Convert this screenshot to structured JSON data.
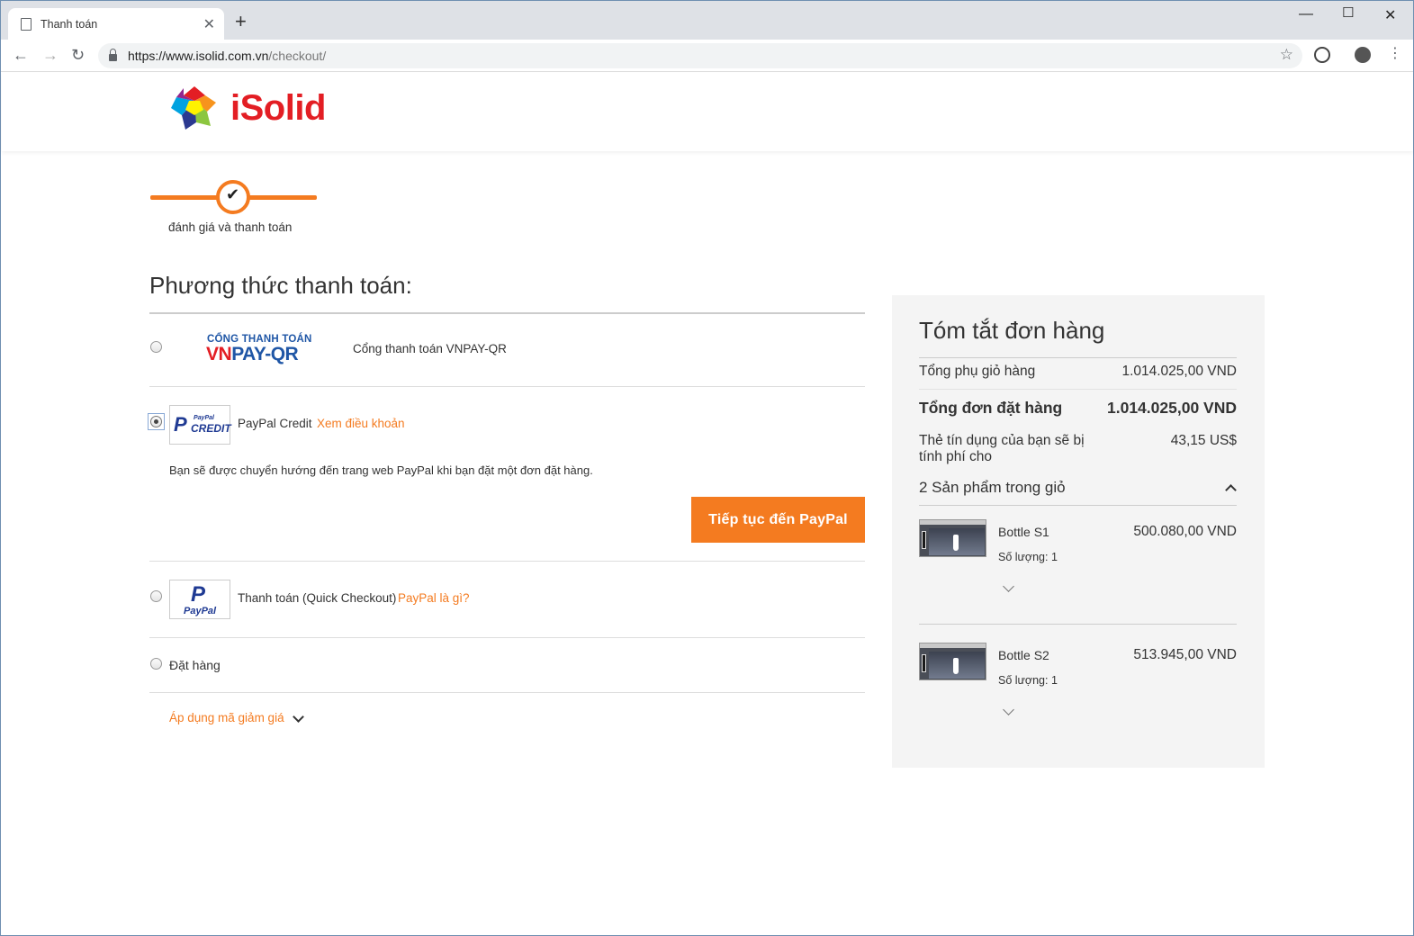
{
  "browser": {
    "tab_title": "Thanh toán",
    "url_host": "https://www.isolid.com.vn",
    "url_path": "/checkout/"
  },
  "header": {
    "brand": "iSolid",
    "brand_color": "#e31e24"
  },
  "progress": {
    "step_label": "đánh giá và thanh toán"
  },
  "payment": {
    "title": "Phương thức thanh toán:",
    "accent_color": "#f47b20",
    "methods": [
      {
        "logo_top": "CỔNG THANH TOÁN",
        "logo_main": "VNPAY-QR",
        "label": "Cổng thanh toán VNPAY-QR",
        "selected": false
      },
      {
        "logo_small": "PayPal",
        "logo_main": "CREDIT",
        "label": "PayPal Credit",
        "link": "Xem điều khoản",
        "selected": true
      },
      {
        "logo_small": "PayPal",
        "label": "Thanh toán (Quick Checkout)",
        "link": "PayPal là gì?",
        "selected": false
      },
      {
        "label": "Đặt hàng",
        "selected": false
      }
    ],
    "redirect_note": "Bạn sẽ được chuyển hướng đến trang web PayPal khi bạn đặt một đơn đặt hàng.",
    "continue_button": "Tiếp tục đến PayPal",
    "discount_label": "Áp dụng mã giảm giá"
  },
  "summary": {
    "title": "Tóm tắt đơn hàng",
    "subtotal_label": "Tổng phụ giỏ hàng",
    "subtotal_value": "1.014.025,00 VND",
    "total_label": "Tổng đơn đặt hàng",
    "total_value": "1.014.025,00 VND",
    "charge_label": "Thẻ tín dụng của bạn sẽ bị tính phí cho",
    "charge_value": "43,15 US$",
    "cart_count_label": "2 Sản phẩm trong giỏ",
    "items": [
      {
        "name": "Bottle S1",
        "qty": "Số lượng: 1",
        "price": "500.080,00 VND"
      },
      {
        "name": "Bottle S2",
        "qty": "Số lượng: 1",
        "price": "513.945,00 VND"
      }
    ]
  }
}
